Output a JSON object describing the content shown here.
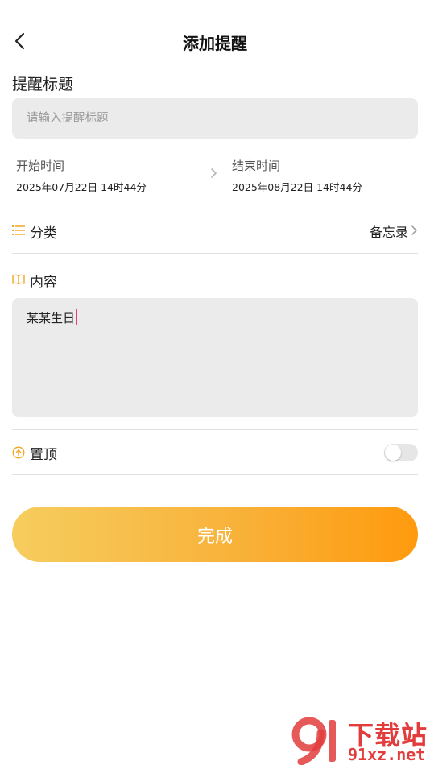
{
  "header": {
    "title": "添加提醒",
    "back_icon": "chevron-left-icon"
  },
  "reminder_title": {
    "label": "提醒标题",
    "value": "",
    "placeholder": "请输入提醒标题"
  },
  "time": {
    "start_label": "开始时间",
    "start_value": "2025年07月22日 14时44分",
    "end_label": "结束时间",
    "end_value": "2025年08月22日 14时44分"
  },
  "category": {
    "icon": "list-icon",
    "label": "分类",
    "value": "备忘录"
  },
  "content": {
    "icon": "book-icon",
    "label": "内容",
    "value": "某某生日"
  },
  "pin": {
    "icon": "pin-top-icon",
    "label": "置顶",
    "enabled": false
  },
  "done_button": {
    "label": "完成"
  },
  "watermark": {
    "text_cn": "下载站",
    "text_url": "91xz.net"
  },
  "colors": {
    "accent": "#f5a623",
    "button_gradient_start": "#f6cd5e",
    "button_gradient_end": "#ff9a0e",
    "input_bg": "#ebebeb",
    "caret": "#e8417a",
    "watermark": "#e23c3c"
  }
}
